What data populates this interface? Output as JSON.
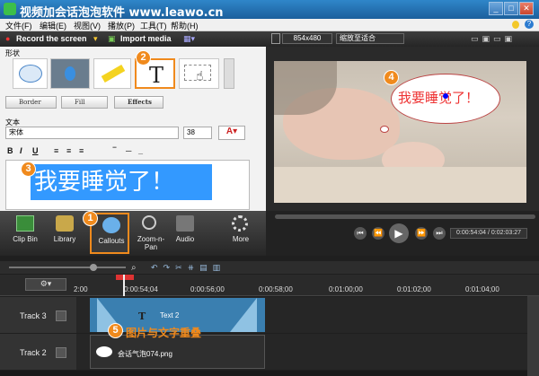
{
  "window": {
    "title": "视频加会话泡泡软件  www.leawo.cn"
  },
  "menu": [
    "文件(F)",
    "编辑(E)",
    "视图(V)",
    "播放(P)",
    "工具(T)",
    "帮助(H)"
  ],
  "toolbar": {
    "record": "Record the screen",
    "import": "Import media"
  },
  "shape_section": "形状",
  "style_buttons": {
    "border": "Border",
    "fill": "Fill",
    "effects": "Effects"
  },
  "text_section": "文本",
  "font": {
    "name": "宋体",
    "size": "38"
  },
  "callout_text": "我要睡觉了！",
  "preview": {
    "resolution": "854x480",
    "zoom": "缩放至适合",
    "bubble_text": "我要睡觉了！"
  },
  "tools": [
    {
      "label": "Clip Bin"
    },
    {
      "label": "Library"
    },
    {
      "label": "Callouts"
    },
    {
      "label": "Zoom-n-Pan"
    },
    {
      "label": "Audio"
    },
    {
      "label": "More"
    }
  ],
  "player": {
    "time": "0:00:54:04 / 0:02:03:27"
  },
  "ruler": [
    "2:00",
    "0:00:54;04",
    "0:00:56;00",
    "0:00:58;00",
    "0:01:00;00",
    "0:01:02;00",
    "0:01:04;00"
  ],
  "tracks": [
    {
      "name": "Track 3",
      "clip": "Text 2"
    },
    {
      "name": "Track 2",
      "clip": "会话气泡074.png"
    }
  ],
  "annotations": {
    "n1": "1",
    "n2": "2",
    "n3": "3",
    "n4": "4",
    "n5": "5",
    "overlap_note": "图片与文字重叠"
  },
  "colors": {
    "accent": "#f08a1d",
    "selection": "#3399ff",
    "title_bar": "#1c5f9c"
  }
}
